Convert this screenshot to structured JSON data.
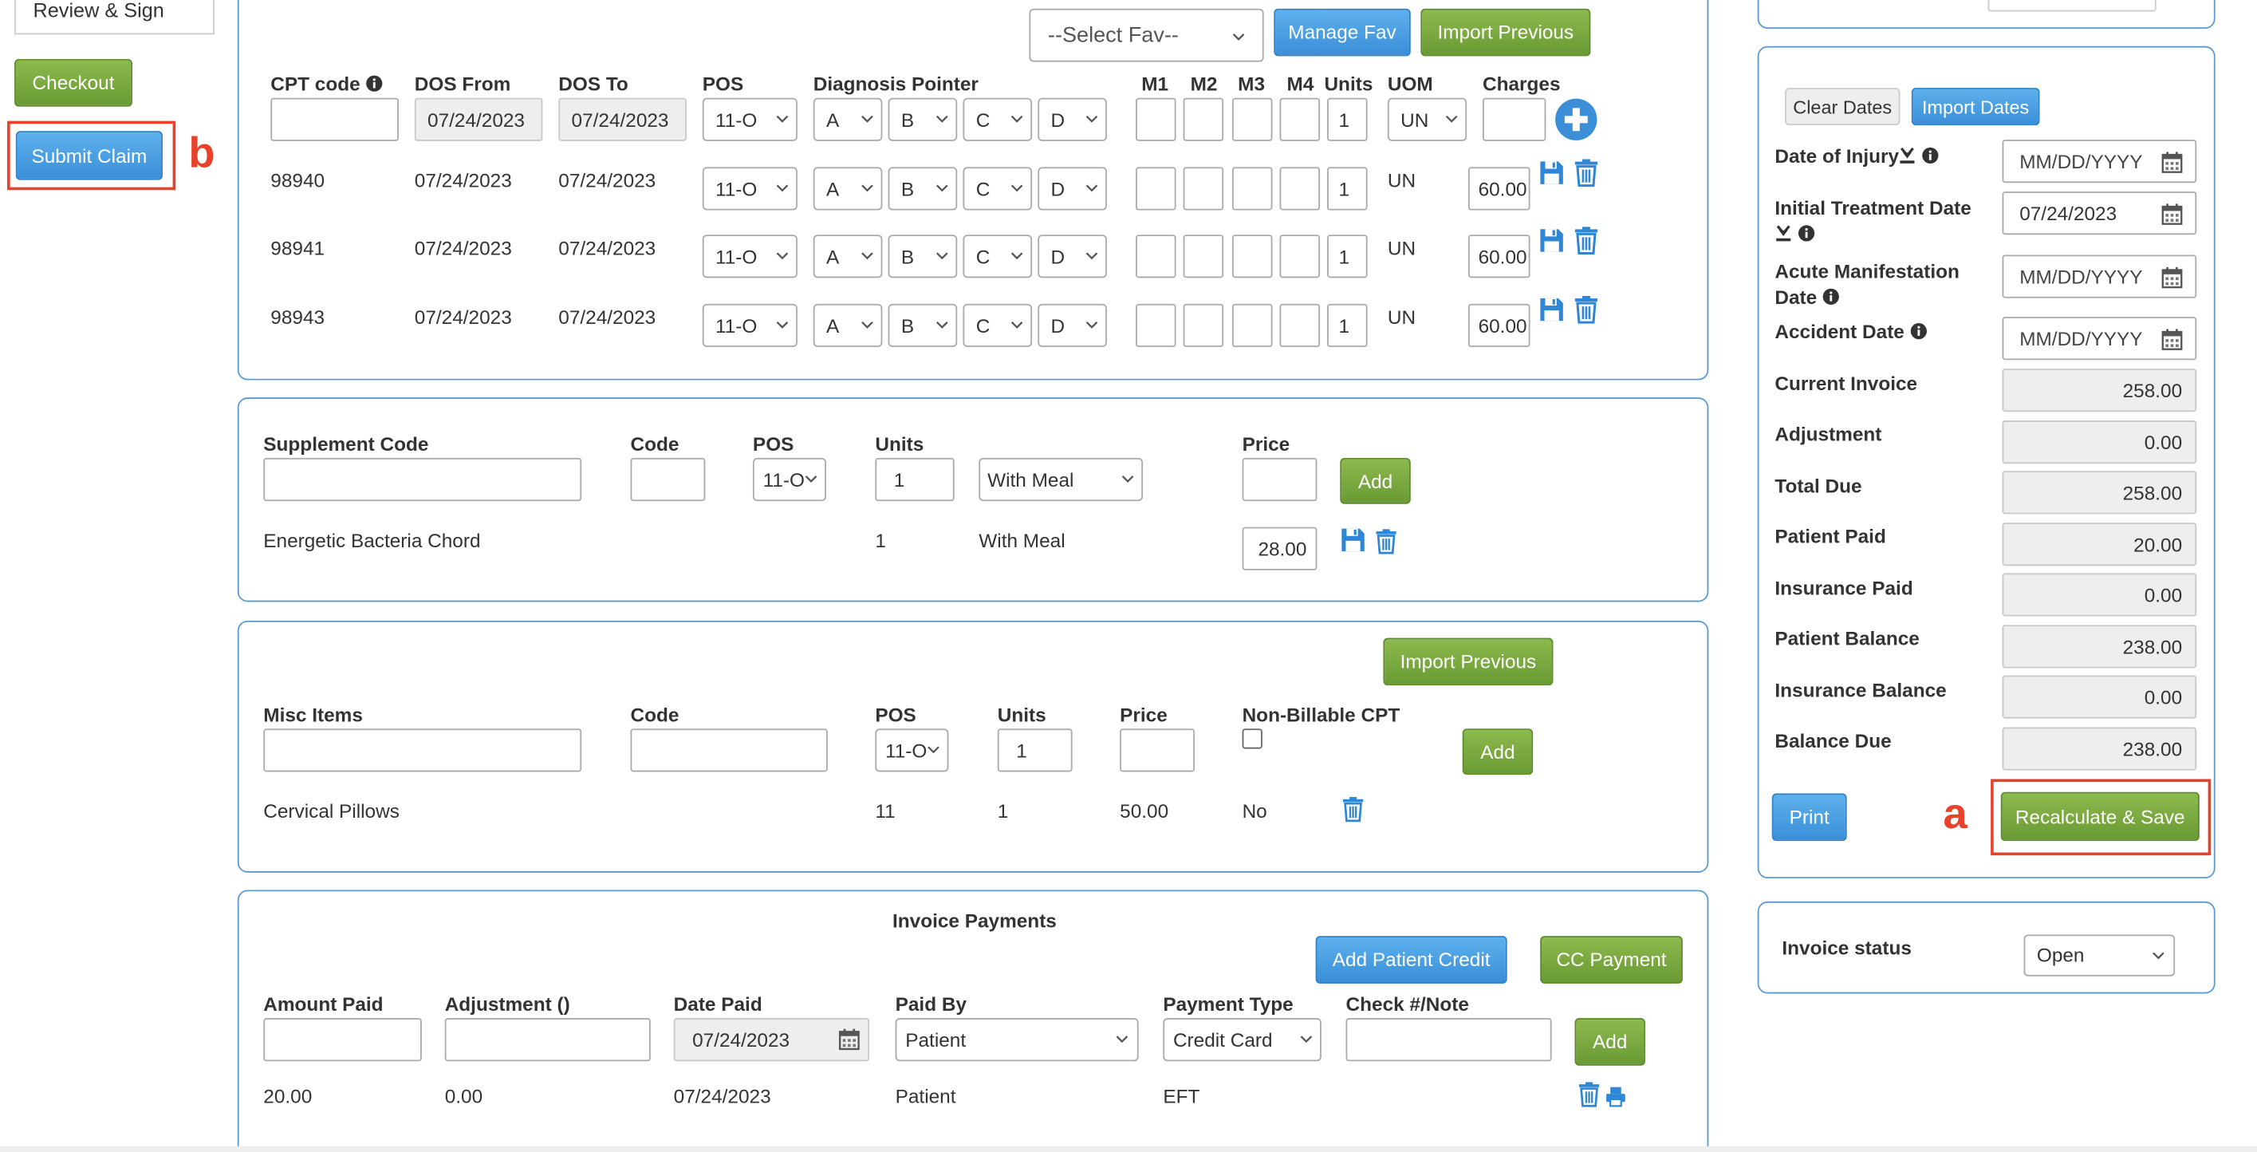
{
  "left_nav": {
    "review_sign": "Review & Sign",
    "checkout": "Checkout",
    "submit_claim": "Submit Claim"
  },
  "annotations": {
    "a": "a",
    "b": "b"
  },
  "cpt": {
    "select_fav": "--Select Fav--",
    "manage_fav": "Manage Fav",
    "import_previous": "Import Previous",
    "headers": {
      "cpt_code": "CPT code",
      "dos_from": "DOS From",
      "dos_to": "DOS To",
      "pos": "POS",
      "diagnosis_pointer": "Diagnosis Pointer",
      "m1": "M1",
      "m2": "M2",
      "m3": "M3",
      "m4": "M4",
      "units": "Units",
      "uom": "UOM",
      "charges": "Charges"
    },
    "entry": {
      "dos_from": "07/24/2023",
      "dos_to": "07/24/2023",
      "pos": "11-O",
      "p1": "A",
      "p2": "B",
      "p3": "C",
      "p4": "D",
      "units": "1",
      "uom": "UN"
    },
    "rows": [
      {
        "code": "98940",
        "dos_from": "07/24/2023",
        "dos_to": "07/24/2023",
        "pos": "11-O",
        "p1": "A",
        "p2": "B",
        "p3": "C",
        "p4": "D",
        "units": "1",
        "uom": "UN",
        "charge": "60.00"
      },
      {
        "code": "98941",
        "dos_from": "07/24/2023",
        "dos_to": "07/24/2023",
        "pos": "11-O",
        "p1": "A",
        "p2": "B",
        "p3": "C",
        "p4": "D",
        "units": "1",
        "uom": "UN",
        "charge": "60.00"
      },
      {
        "code": "98943",
        "dos_from": "07/24/2023",
        "dos_to": "07/24/2023",
        "pos": "11-O",
        "p1": "A",
        "p2": "B",
        "p3": "C",
        "p4": "D",
        "units": "1",
        "uom": "UN",
        "charge": "60.00"
      }
    ]
  },
  "supplement": {
    "headers": {
      "supplement_code": "Supplement Code",
      "code": "Code",
      "pos": "POS",
      "units": "Units",
      "price": "Price"
    },
    "entry": {
      "pos": "11-O",
      "units": "1",
      "meal": "With Meal"
    },
    "add": "Add",
    "row": {
      "name": "Energetic Bacteria Chord",
      "units": "1",
      "meal": "With Meal",
      "price": "28.00"
    }
  },
  "misc": {
    "import_previous": "Import Previous",
    "headers": {
      "misc_items": "Misc Items",
      "code": "Code",
      "pos": "POS",
      "units": "Units",
      "price": "Price",
      "non_billable": "Non-Billable CPT"
    },
    "entry": {
      "pos": "11-O",
      "units": "1"
    },
    "add": "Add",
    "row": {
      "name": "Cervical Pillows",
      "pos": "11",
      "units": "1",
      "price": "50.00",
      "non_billable": "No"
    }
  },
  "payments": {
    "title": "Invoice Payments",
    "add_patient_credit": "Add Patient Credit",
    "cc_payment": "CC Payment",
    "headers": {
      "amount_paid": "Amount Paid",
      "adjustment": "Adjustment ()",
      "date_paid": "Date Paid",
      "paid_by": "Paid By",
      "payment_type": "Payment Type",
      "check_note": "Check #/Note"
    },
    "entry": {
      "date_paid": "07/24/2023",
      "paid_by": "Patient",
      "payment_type": "Credit Card"
    },
    "add": "Add",
    "row": {
      "amount": "20.00",
      "adjustment": "0.00",
      "date": "07/24/2023",
      "paid_by": "Patient",
      "type": "EFT"
    }
  },
  "summary": {
    "clear_dates": "Clear Dates",
    "import_dates": "Import Dates",
    "date_of_injury": "Date of Injury",
    "initial_treatment_date": "Initial Treatment Date",
    "acute_manifestation_line1": "Acute Manifestation",
    "acute_manifestation_line2": "Date",
    "accident_date": "Accident Date",
    "date_placeholder": "MM/DD/YYYY",
    "initial_treatment_value": "07/24/2023",
    "current_invoice": "Current Invoice",
    "current_invoice_val": "258.00",
    "adjustment": "Adjustment",
    "adjustment_val": "0.00",
    "total_due": "Total Due",
    "total_due_val": "258.00",
    "patient_paid": "Patient Paid",
    "patient_paid_val": "20.00",
    "insurance_paid": "Insurance Paid",
    "insurance_paid_val": "0.00",
    "patient_balance": "Patient Balance",
    "patient_balance_val": "238.00",
    "insurance_balance": "Insurance Balance",
    "insurance_balance_val": "0.00",
    "balance_due": "Balance Due",
    "balance_due_val": "238.00",
    "print": "Print",
    "recalculate_save": "Recalculate & Save"
  },
  "invoice_status": {
    "label": "Invoice status",
    "value": "Open"
  },
  "icons": [
    "info-icon",
    "calendar-icon",
    "save-icon",
    "trash-icon",
    "plus-circle-icon",
    "print-icon",
    "chevron-down-icon",
    "import-icon"
  ],
  "colors": {
    "green": "#6a9a34",
    "blue": "#3a8fd8",
    "panel_border": "#5b9bd5",
    "annotation_red": "#e8412c"
  }
}
